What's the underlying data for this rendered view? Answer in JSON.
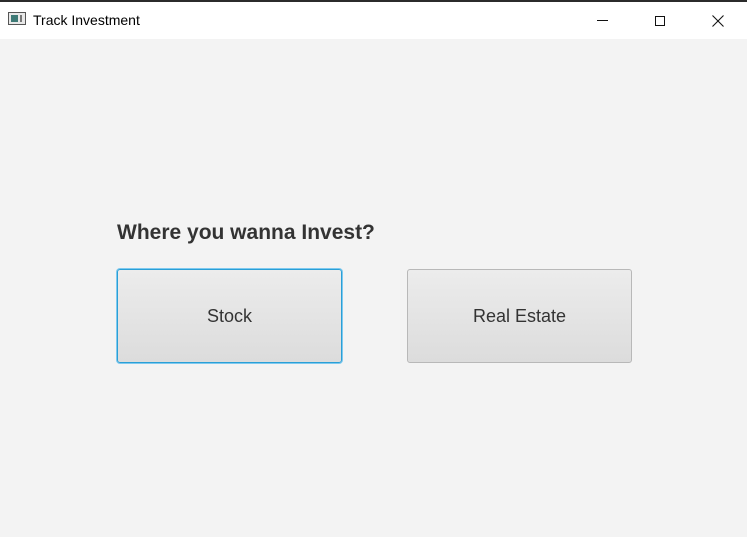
{
  "window": {
    "title": "Track Investment",
    "controls": [
      "minimize",
      "maximize",
      "close"
    ]
  },
  "main": {
    "question": "Where you wanna Invest?",
    "options": [
      {
        "label": "Stock",
        "focused": true
      },
      {
        "label": "Real Estate",
        "focused": false
      }
    ]
  },
  "colors": {
    "background": "#f3f3f3",
    "focus_ring": "#2a9fd6",
    "text": "#333333"
  }
}
